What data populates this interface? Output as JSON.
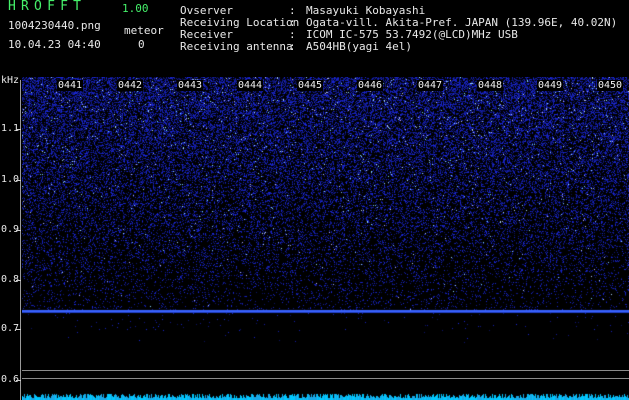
{
  "header": {
    "app_title": "HROFFT",
    "app_version": "1.00",
    "file_name": "1004230440.png",
    "date_time": "10.04.23 04:40",
    "meteor_label": "meteor",
    "meteor_count": "0"
  },
  "info": [
    {
      "label": "Ovserver",
      "value": "Masayuki Kobayashi"
    },
    {
      "label": "Receiving Location",
      "value": "Ogata-vill. Akita-Pref. JAPAN (139.96E, 40.02N)"
    },
    {
      "label": "Receiver",
      "value": "ICOM IC-575 53.7492(@LCD)MHz USB"
    },
    {
      "label": "Receiving antenna",
      "value": "A504HB(yagi 4el)"
    }
  ],
  "spectrogram": {
    "y_unit": "kHz",
    "y_ticks": [
      "1.1",
      "1.0",
      "0.9",
      "0.8",
      "0.7",
      "0.6"
    ],
    "time_labels": [
      "0441",
      "0442",
      "0443",
      "0444",
      "0445",
      "0446",
      "0447",
      "0448",
      "0449",
      "0450"
    ],
    "colors": {
      "signal": "#3a63ff",
      "noise": "#1c2bd8",
      "baseline": "#00c8ff",
      "text_green": "#45f06a"
    }
  }
}
